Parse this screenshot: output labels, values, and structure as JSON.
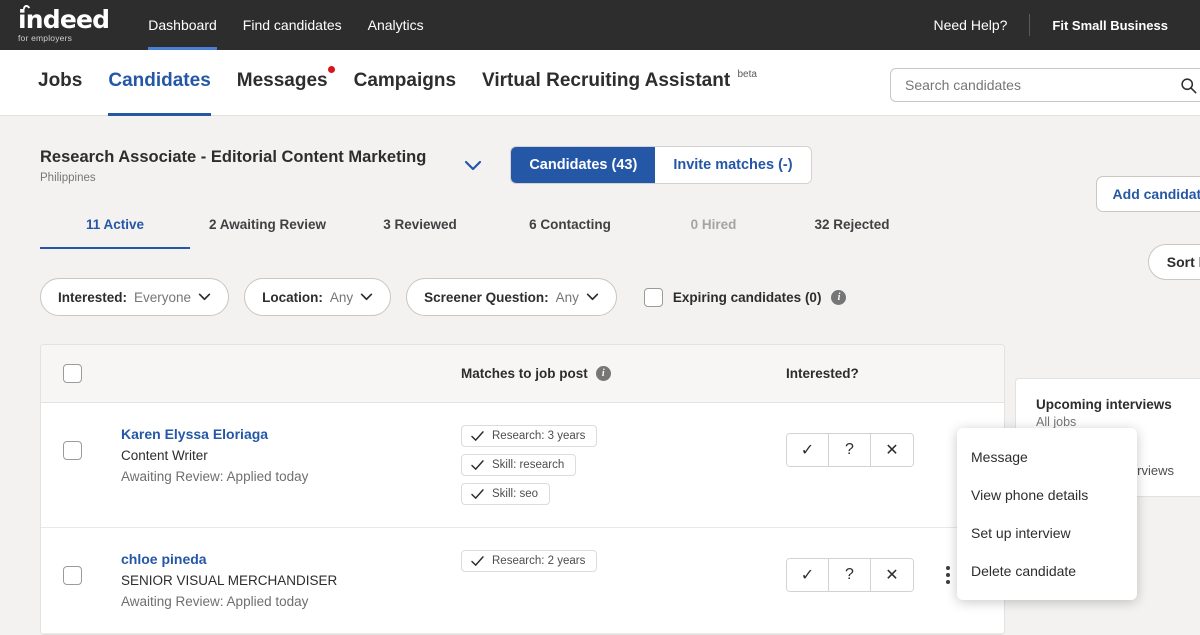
{
  "topbar": {
    "logo": "indeed",
    "logo_sub": "for employers",
    "nav": [
      {
        "label": "Dashboard",
        "active": true
      },
      {
        "label": "Find candidates",
        "active": false
      },
      {
        "label": "Analytics",
        "active": false
      }
    ],
    "need_help": "Need Help?",
    "account": "Fit Small Business"
  },
  "subnav": {
    "items": [
      {
        "label": "Jobs",
        "active": false,
        "dot": false,
        "beta": false
      },
      {
        "label": "Candidates",
        "active": true,
        "dot": false,
        "beta": false
      },
      {
        "label": "Messages",
        "active": false,
        "dot": true,
        "beta": false
      },
      {
        "label": "Campaigns",
        "active": false,
        "dot": false,
        "beta": false
      },
      {
        "label": "Virtual Recruiting Assistant",
        "active": false,
        "dot": false,
        "beta": true
      }
    ],
    "beta_label": "beta"
  },
  "search": {
    "placeholder": "Search candidates",
    "value": ""
  },
  "job": {
    "title": "Research Associate - Editorial Content Marketing",
    "location": "Philippines",
    "segments": [
      {
        "label": "Candidates  (43)",
        "active": true
      },
      {
        "label": "Invite matches  (-)",
        "active": false
      }
    ]
  },
  "actions": {
    "add_candidate": "Add candidate",
    "sort_by": "Sort by"
  },
  "status_tabs": [
    {
      "label": "11 Active",
      "active": true,
      "disabled": false
    },
    {
      "label": "2 Awaiting Review",
      "active": false,
      "disabled": false
    },
    {
      "label": "3 Reviewed",
      "active": false,
      "disabled": false
    },
    {
      "label": "6 Contacting",
      "active": false,
      "disabled": false
    },
    {
      "label": "0 Hired",
      "active": false,
      "disabled": true
    },
    {
      "label": "32 Rejected",
      "active": false,
      "disabled": false
    }
  ],
  "filters": [
    {
      "label": "Interested:",
      "value": "Everyone"
    },
    {
      "label": "Location:",
      "value": "Any"
    },
    {
      "label": "Screener Question:",
      "value": "Any"
    }
  ],
  "expiring": {
    "label": "Expiring candidates (0)",
    "checked": false
  },
  "table": {
    "headers": {
      "matches": "Matches to job post",
      "interested": "Interested?"
    },
    "rows": [
      {
        "name": "Karen Elyssa Eloriaga",
        "role": "Content Writer",
        "status": "Awaiting Review: Applied today",
        "matches": [
          "Research: 3 years",
          "Skill: research",
          "Skill: seo"
        ]
      },
      {
        "name": "chloe pineda",
        "role": "SENIOR VISUAL MERCHANDISER",
        "status": "Awaiting Review: Applied today",
        "matches": [
          "Research: 2 years"
        ]
      }
    ],
    "interest_buttons": [
      {
        "glyph": "✓",
        "name": "yes"
      },
      {
        "glyph": "?",
        "name": "maybe"
      },
      {
        "glyph": "✕",
        "name": "no"
      }
    ]
  },
  "right_panel": {
    "title": "Upcoming interviews",
    "subtitle": "All jobs",
    "body": "No upcoming interviews"
  },
  "context_menu": [
    "Message",
    "View phone details",
    "Set up interview",
    "Delete candidate"
  ],
  "colors": {
    "brand_blue": "#2557a7",
    "topbar_bg": "#2d2d2d",
    "page_bg": "#f3f2f1",
    "alert_red": "#d7141a"
  }
}
